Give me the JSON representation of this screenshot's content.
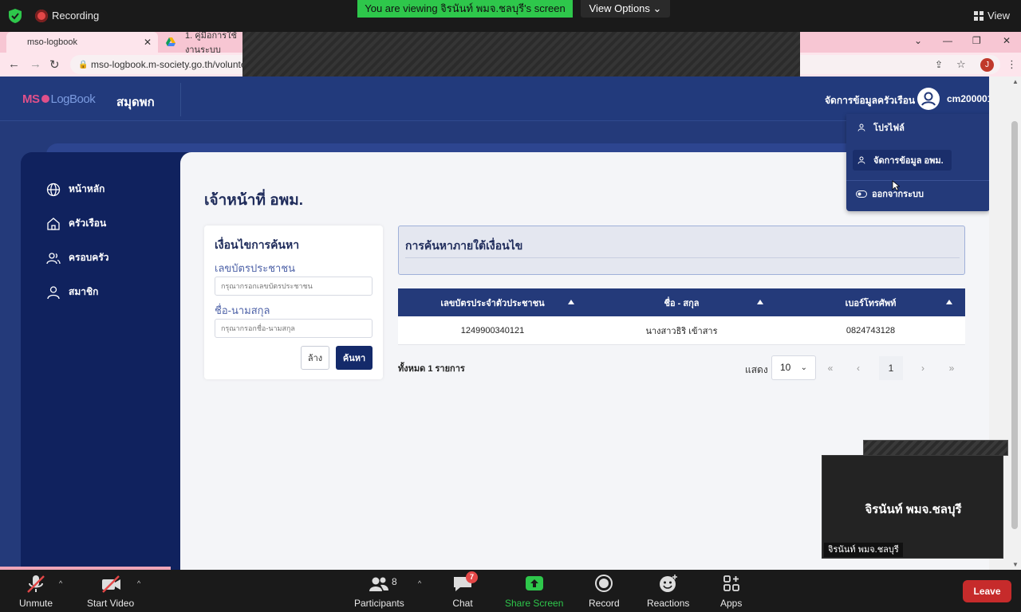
{
  "zoom": {
    "recording_label": "Recording",
    "viewing_banner": "You are viewing จิรนันท์ พมจ.ชลบุรี's screen",
    "view_options": "View Options",
    "view_button": "View",
    "bottom": {
      "unmute": "Unmute",
      "start_video": "Start Video",
      "participants": "Participants",
      "participants_count": "8",
      "chat": "Chat",
      "chat_badge": "7",
      "share_screen": "Share Screen",
      "record": "Record",
      "reactions": "Reactions",
      "apps": "Apps",
      "leave": "Leave"
    },
    "video_tile": {
      "name": "จิรนันท์ พมจ.ชลบุรี",
      "label": "จิรนันท์ พมจ.ชลบุรี"
    },
    "colors": {
      "green": "#2ec74b",
      "leave": "#c62b2b"
    }
  },
  "browser": {
    "tabs": [
      {
        "label": "mso-logbook"
      },
      {
        "label": "1. คู่มือการใช้งานระบบ"
      }
    ],
    "url": "mso-logbook.m-society.go.th/voluntee",
    "profile_initial": "J"
  },
  "app": {
    "logo_mso": "MS",
    "logo_book": "LogBook",
    "title": "สมุดพก",
    "manage_link": "จัดการข้อมูลครัวเรือน",
    "username": "cm200001",
    "sidebar": [
      {
        "label": "หน้าหลัก",
        "icon": "globe-icon"
      },
      {
        "label": "ครัวเรือน",
        "icon": "house-icon"
      },
      {
        "label": "ครอบครัว",
        "icon": "users-icon"
      },
      {
        "label": "สมาชิก",
        "icon": "user-icon"
      }
    ],
    "page_title": "เจ้าหน้าที่ อพม.",
    "search": {
      "title": "เงื่อนไขการค้นหา",
      "id_label": "เลขบัตรประชาชน",
      "id_placeholder": "กรุณากรอกเลขบัตรประชาชน",
      "name_label": "ชื่อ-นามสกุล",
      "name_placeholder": "กรุณากรอกชื่อ-นามสกุล",
      "clear": "ล้าง",
      "submit": "ค้นหา"
    },
    "results_title": "การค้นหาภายใต้เงื่อนไข",
    "table": {
      "headers": [
        "เลขบัตรประจำตัวประชาชน",
        "ชื่อ - สกุล",
        "เบอร์โทรศัพท์"
      ],
      "rows": [
        [
          "1249900340121",
          "นางสาวธิริ เข้าสาร",
          "0824743128"
        ]
      ]
    },
    "total": "ทั้งหมด 1 รายการ",
    "show_label": "แสดง",
    "page_size": "10",
    "pagination": {
      "first": "«",
      "prev": "‹",
      "current": "1",
      "next": "›",
      "last": "»"
    },
    "dropdown": {
      "profile": "โปรไฟล์",
      "manage_data": "จัดการข้อมูล อพม.",
      "logout": "ออกจากระบบ"
    },
    "colors": {
      "navy": "#243a7a",
      "sidebar": "#10225e",
      "pink": "#e0508a"
    }
  }
}
